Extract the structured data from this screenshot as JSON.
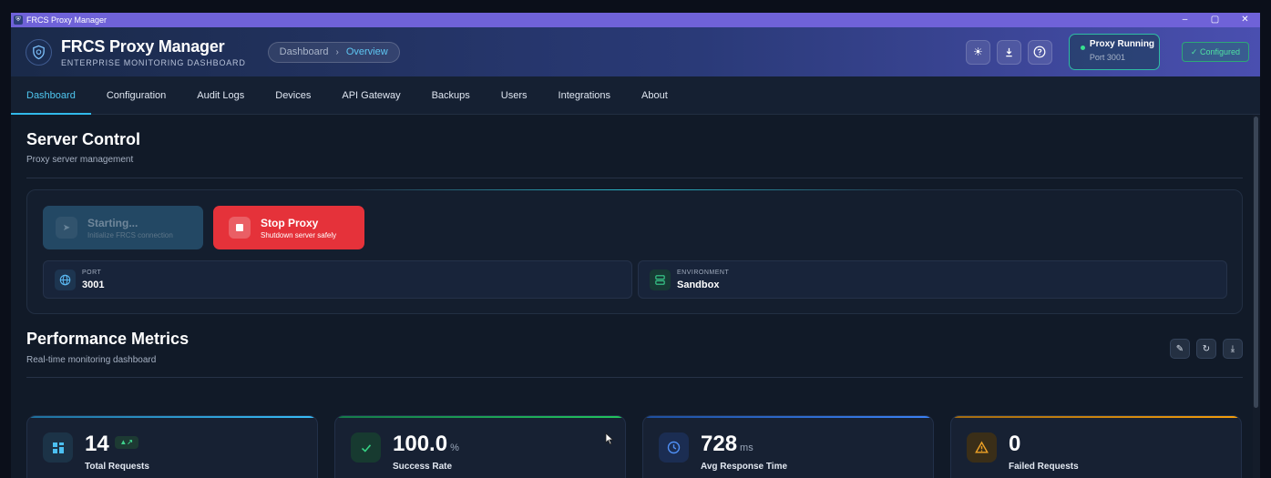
{
  "window": {
    "title": "FRCS Proxy Manager",
    "controls": [
      "–",
      "▢",
      "✕"
    ]
  },
  "header": {
    "brand_title": "FRCS Proxy Manager",
    "brand_subtitle": "ENTERPRISE MONITORING DASHBOARD",
    "breadcrumb": {
      "root": "Dashboard",
      "separator": "›",
      "current": "Overview"
    },
    "icons": [
      "sun-icon",
      "download-icon",
      "help-icon"
    ],
    "status": {
      "title": "Proxy Running",
      "detail": "Port 3001"
    },
    "configured_label": "✓ Configured"
  },
  "tabs": [
    "Dashboard",
    "Configuration",
    "Audit Logs",
    "Devices",
    "API Gateway",
    "Backups",
    "Users",
    "Integrations",
    "About"
  ],
  "server_control": {
    "title": "Server Control",
    "subtitle": "Proxy server management",
    "start": {
      "label": "Starting...",
      "sub": "Initialize FRCS connection"
    },
    "stop": {
      "label": "Stop Proxy",
      "sub": "Shutdown server safely"
    },
    "port": {
      "label": "PORT",
      "value": "3001"
    },
    "environment": {
      "label": "ENVIRONMENT",
      "value": "Sandbox"
    }
  },
  "performance": {
    "title": "Performance Metrics",
    "subtitle": "Real-time monitoring dashboard"
  },
  "metrics": [
    {
      "value": "14",
      "unit": "",
      "label": "Total Requests",
      "accent": "#38bdf8",
      "trend": "▲↗"
    },
    {
      "value": "100.0",
      "unit": "%",
      "label": "Success Rate",
      "accent": "#22c55e"
    },
    {
      "value": "728",
      "unit": "ms",
      "label": "Avg Response Time",
      "accent": "#3b82f6"
    },
    {
      "value": "0",
      "unit": "",
      "label": "Failed Requests",
      "accent": "#f59e0b"
    }
  ],
  "colors": {
    "accent": "#31b9ea",
    "danger": "#e5323a",
    "success": "#37e08f"
  }
}
